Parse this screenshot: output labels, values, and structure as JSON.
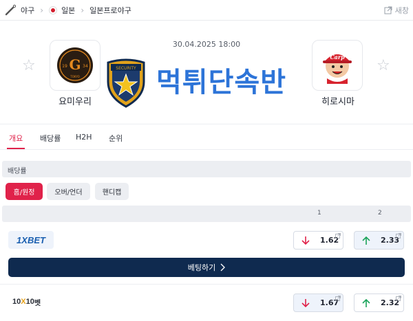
{
  "breadcrumb": {
    "items": [
      {
        "label": "야구",
        "icon": "baseball-bat-icon"
      },
      {
        "label": "일본",
        "icon": "japan-flag-icon"
      },
      {
        "label": "일본프로야구"
      }
    ],
    "new_window_label": "새창"
  },
  "match": {
    "datetime": "30.04.2025 18:00",
    "home": {
      "name": "요미우리",
      "logo_text": "G",
      "logo_year_left": "19",
      "logo_year_right": "34",
      "logo_city": "TOKYO"
    },
    "away": {
      "name": "히로시마",
      "logo_text": "Carp"
    },
    "watermark": "먹튀단속반",
    "badge_text": "SECURITY"
  },
  "tabs": [
    {
      "label": "개요",
      "active": true
    },
    {
      "label": "배당률",
      "active": false
    },
    {
      "label": "H2H",
      "active": false
    },
    {
      "label": "순위",
      "active": false
    }
  ],
  "odds_section": {
    "title": "배당률",
    "filters": [
      {
        "label": "홈/원정",
        "active": true
      },
      {
        "label": "오버/언더",
        "active": false
      },
      {
        "label": "핸디캡",
        "active": false
      }
    ],
    "col_1": "1",
    "col_2": "2"
  },
  "bookmakers": [
    {
      "name": "1XBET",
      "odd_1": "1.62",
      "odd_1_trend": "down",
      "odd_2": "2.33",
      "odd_2_trend": "up",
      "bet_label": "베팅하기"
    },
    {
      "name_a": "10",
      "name_x": "X",
      "name_b": "10",
      "name_suffix": "벳",
      "odd_1": "1.67",
      "odd_1_trend": "down",
      "odd_2": "2.32",
      "odd_2_trend": "up"
    }
  ],
  "colors": {
    "accent": "#e0224a",
    "navy": "#0f2a4f",
    "down": "#e0224a",
    "up": "#1aa35a",
    "watermark": "#2d74d8"
  }
}
